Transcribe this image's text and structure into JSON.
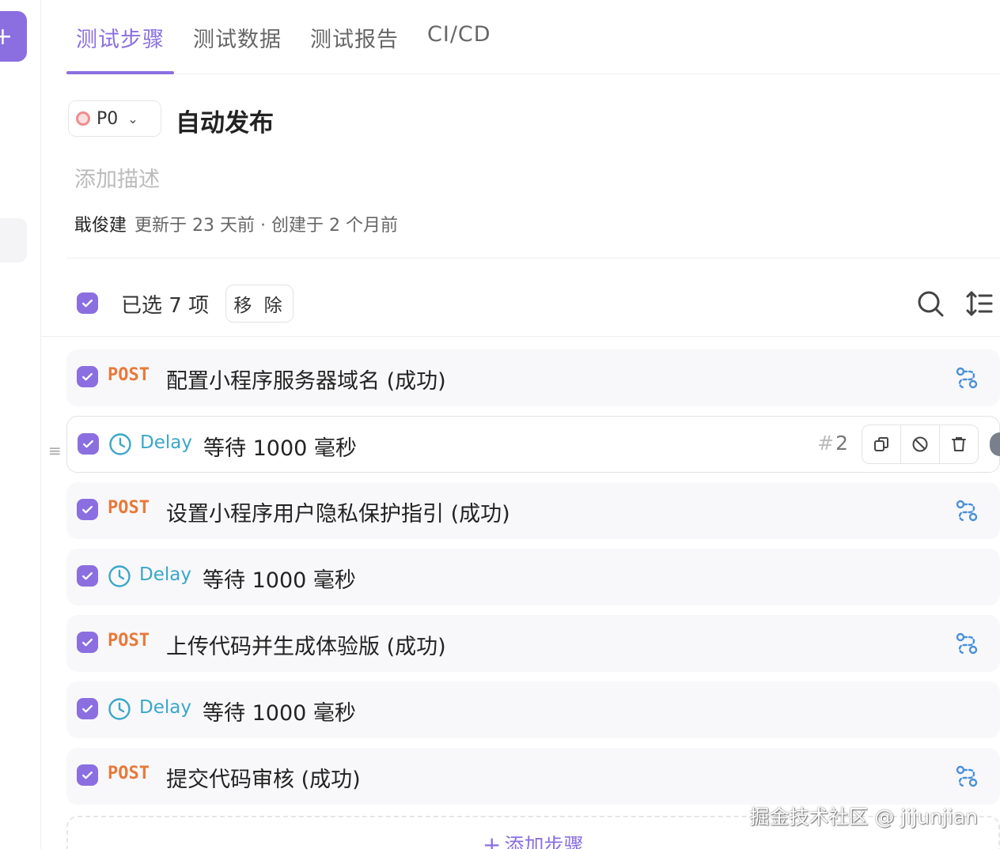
{
  "rail": {
    "add_icon": "plus-icon",
    "add_label": "+"
  },
  "tabs": [
    {
      "label": "测试步骤",
      "active": true
    },
    {
      "label": "测试数据",
      "active": false
    },
    {
      "label": "测试报告",
      "active": false
    },
    {
      "label": "CI/CD",
      "active": false
    }
  ],
  "case": {
    "priority": "P0",
    "title": "自动发布",
    "description_placeholder": "添加描述",
    "author": "戢俊建",
    "meta": "更新于 23 天前 · 创建于 2 个月前"
  },
  "selection": {
    "text": "已选 7 项",
    "remove_label": "移 除"
  },
  "steps": [
    {
      "type": "POST",
      "title": "配置小程序服务器域名 (成功)"
    },
    {
      "type": "Delay",
      "title": "等待 1000 毫秒",
      "number": "2"
    },
    {
      "type": "POST",
      "title": "设置小程序用户隐私保护指引 (成功)"
    },
    {
      "type": "Delay",
      "title": "等待 1000 毫秒"
    },
    {
      "type": "POST",
      "title": "上传代码并生成体验版 (成功)"
    },
    {
      "type": "Delay",
      "title": "等待 1000 毫秒"
    },
    {
      "type": "POST",
      "title": "提交代码审核 (成功)"
    }
  ],
  "add_step_label": "添加步骤",
  "add_step_plus": "+",
  "drag_glyph": "≡",
  "hash_glyph": "#",
  "chevron_glyph": "⌄",
  "watermark": "掘金技术社区 @ jijunjian",
  "colors": {
    "accent": "#8b6fe0",
    "post": "#e8793a",
    "delay": "#3aa7c9",
    "flow_icon": "#4a90d9"
  }
}
